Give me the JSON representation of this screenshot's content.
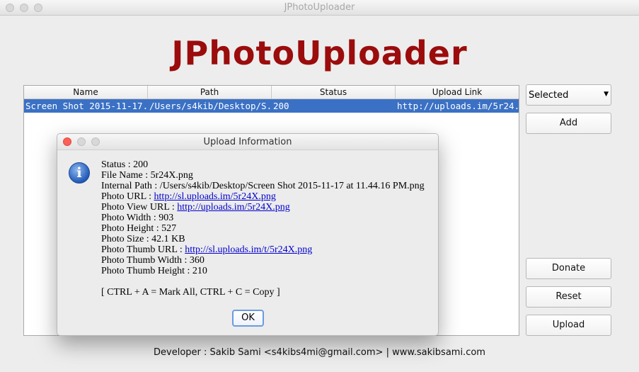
{
  "window": {
    "title": "JPhotoUploader"
  },
  "app": {
    "logo_text": "JPhotoUploader"
  },
  "table": {
    "columns": [
      "Name",
      "Path",
      "Status",
      "Upload Link"
    ],
    "rows": [
      {
        "name": "Screen Shot 2015-11-17...",
        "path": "/Users/s4kib/Desktop/S...",
        "status": "200",
        "link": "http://uploads.im/5r24..."
      }
    ]
  },
  "controls": {
    "filter_select": "Selected",
    "add": "Add",
    "donate": "Donate",
    "reset": "Reset",
    "upload": "Upload"
  },
  "footer": {
    "text": "Developer : Sakib Sami <s4kibs4mi@gmail.com> | www.sakibsami.com"
  },
  "dialog": {
    "title": "Upload Information",
    "lines": {
      "status": "Status : 200",
      "file_name": "File Name : 5r24X.png",
      "internal_path": "Internal Path : /Users/s4kib/Desktop/Screen Shot 2015-11-17 at 11.44.16 PM.png",
      "photo_url_label": "Photo URL : ",
      "photo_url": "http://sl.uploads.im/5r24X.png",
      "photo_view_url_label": "Photo View URL : ",
      "photo_view_url": "http://uploads.im/5r24X.png",
      "photo_width": "Photo Width : 903",
      "photo_height": "Photo Height : 527",
      "photo_size": "Photo Size : 42.1 KB",
      "thumb_url_label": "Photo Thumb URL : ",
      "thumb_url": "http://sl.uploads.im/t/5r24X.png",
      "thumb_width": "Photo Thumb Width : 360",
      "thumb_height": "Photo Thumb Height : 210"
    },
    "shortcut_hint": "[ CTRL + A = Mark All, CTRL + C = Copy ]",
    "ok": "OK"
  },
  "colors": {
    "logo": "#9b0c0c",
    "selection": "#3b71c4",
    "link": "#0000cc"
  }
}
